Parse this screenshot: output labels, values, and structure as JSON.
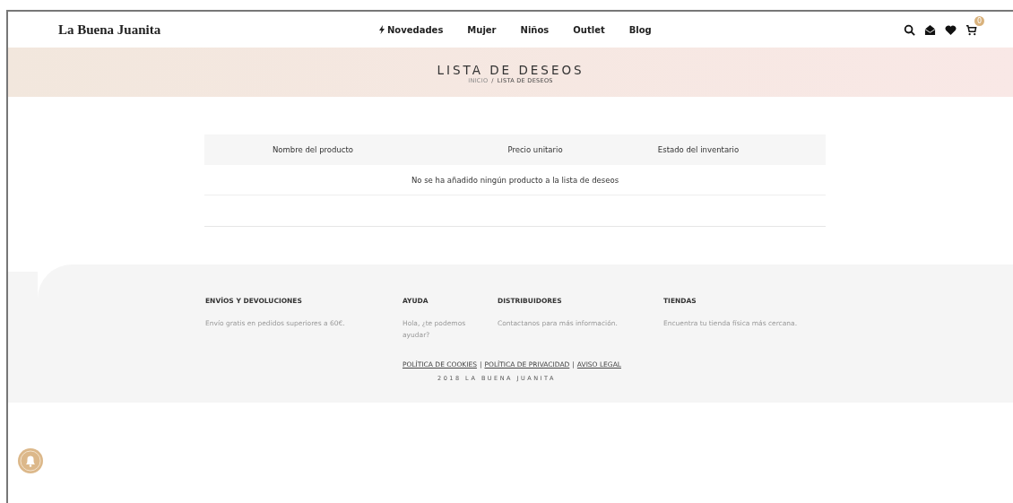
{
  "header": {
    "logo": "La Buena Juanita",
    "nav": [
      {
        "label": "Novedades",
        "kind": "flash"
      },
      {
        "label": "Mujer",
        "kind": "plain"
      },
      {
        "label": "Niños",
        "kind": "plain"
      },
      {
        "label": "Outlet",
        "kind": "plain"
      },
      {
        "label": "Blog",
        "kind": "plain"
      }
    ],
    "cart_count": "0"
  },
  "banner": {
    "title": "LISTA DE DESEOS",
    "breadcrumb": [
      "INICIO",
      "LISTA DE DESEOS"
    ],
    "breadcrumb_separator": "/"
  },
  "table": {
    "columns": [
      "Nombre del producto",
      "Precio unitario",
      "Estado del inventario"
    ],
    "empty_message": "No se ha añadido ningún producto a la lista de deseos"
  },
  "footer": {
    "columns": [
      {
        "heading": "ENVÍOS Y DEVOLUCIONES",
        "text": "Envío gratis en pedidos superiores a 60€."
      },
      {
        "heading": "AYUDA",
        "text": "Hola, ¿te podemos ayudar?"
      },
      {
        "heading": "DISTRIBUIDORES",
        "text": "Contactanos para más información."
      },
      {
        "heading": "TIENDAS",
        "text": "Encuentra tu tienda física más cercana."
      }
    ],
    "legal_links": [
      "POLÍTICA DE COOKIES",
      "POLÍTICA DE PRIVACIDAD",
      "AVISO LEGAL"
    ],
    "legal_separator": "|",
    "copyright": "2018 LA BUENA JUANITA"
  }
}
